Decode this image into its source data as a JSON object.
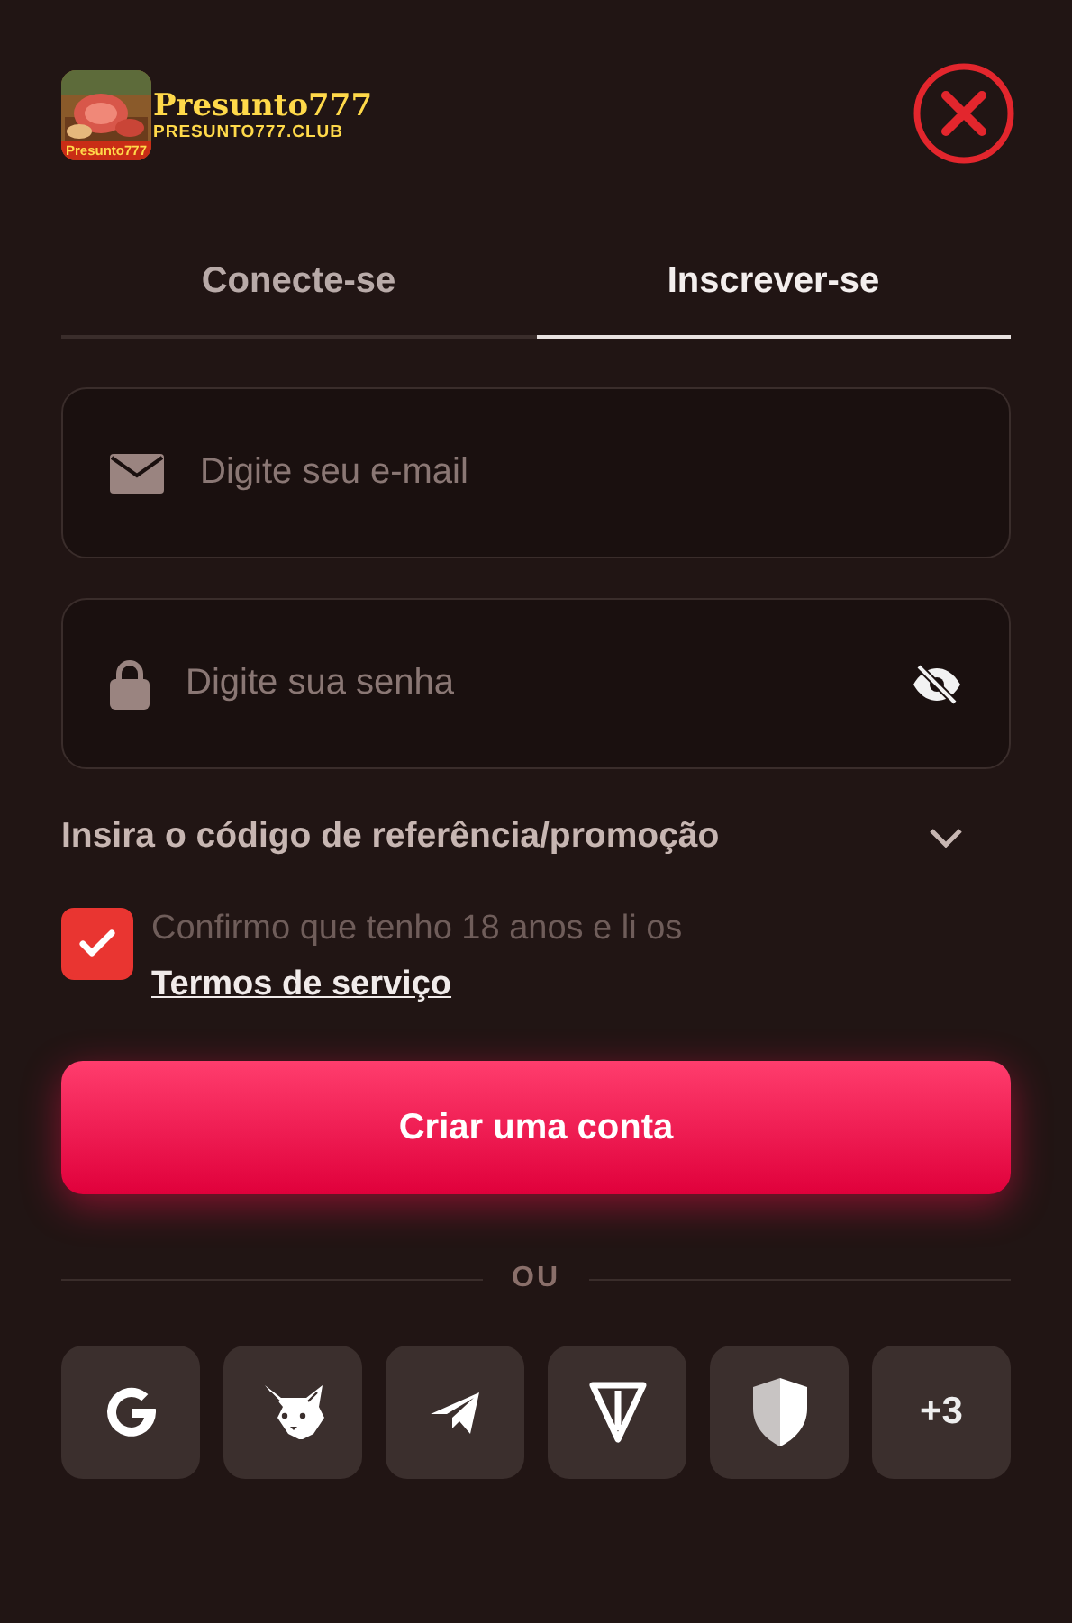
{
  "logo": {
    "badge": "Presunto777",
    "name": "Presunto777",
    "domain": "PRESUNTO777.CLUB"
  },
  "tabs": [
    {
      "label": "Conecte-se",
      "selected": false
    },
    {
      "label": "Inscrever-se",
      "selected": true
    }
  ],
  "email_field": {
    "placeholder": "Digite seu e-mail"
  },
  "password_field": {
    "placeholder": "Digite sua senha"
  },
  "promo": {
    "label": "Insira o código de referência/promoção",
    "expanded": false
  },
  "terms": {
    "checked": true,
    "text": "Confirmo que tenho 18 anos e li os ",
    "link": "Termos de serviço"
  },
  "submit_button": "Criar uma conta",
  "divider": "OU",
  "socials": [
    {
      "kind": "google"
    },
    {
      "kind": "fox"
    },
    {
      "kind": "telegram"
    },
    {
      "kind": "ton"
    },
    {
      "kind": "shield"
    },
    {
      "kind": "more",
      "label": "+3"
    }
  ]
}
